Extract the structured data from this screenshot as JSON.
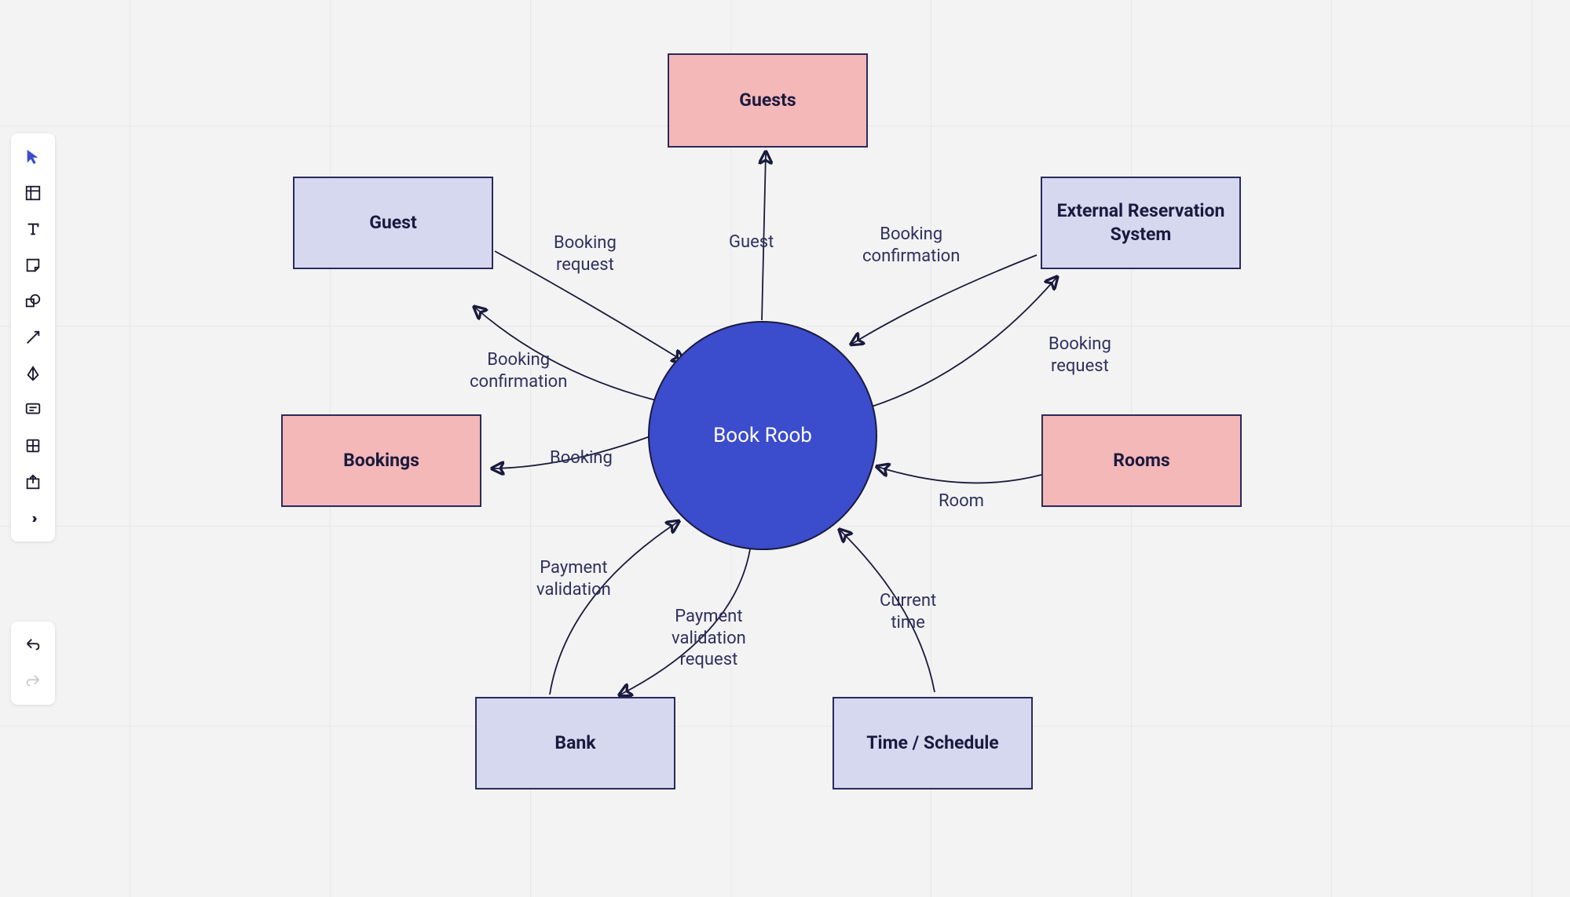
{
  "center": {
    "label": "Book Roob"
  },
  "nodes": {
    "guests": "Guests",
    "guest": "Guest",
    "external": "External Reservation System",
    "bookings": "Bookings",
    "rooms": "Rooms",
    "bank": "Bank",
    "schedule": "Time / Schedule"
  },
  "edges": {
    "guest_to_center": "Booking\nrequest",
    "center_to_guests": "Guest",
    "external_to_center": "Booking\nconfirmation",
    "center_to_guest": "Booking\nconfirmation",
    "center_to_external": "Booking\nrequest",
    "center_to_bookings": "Booking",
    "rooms_to_center": "Room",
    "bank_to_center": "Payment\nvalidation",
    "center_to_bank": "Payment\nvalidation\nrequest",
    "schedule_to_center": "Current\ntime"
  },
  "tools": [
    "select",
    "frame",
    "text",
    "sticky",
    "shape",
    "arrow",
    "pen",
    "comment",
    "section",
    "export",
    "more"
  ],
  "history_tools": [
    "undo",
    "redo"
  ]
}
